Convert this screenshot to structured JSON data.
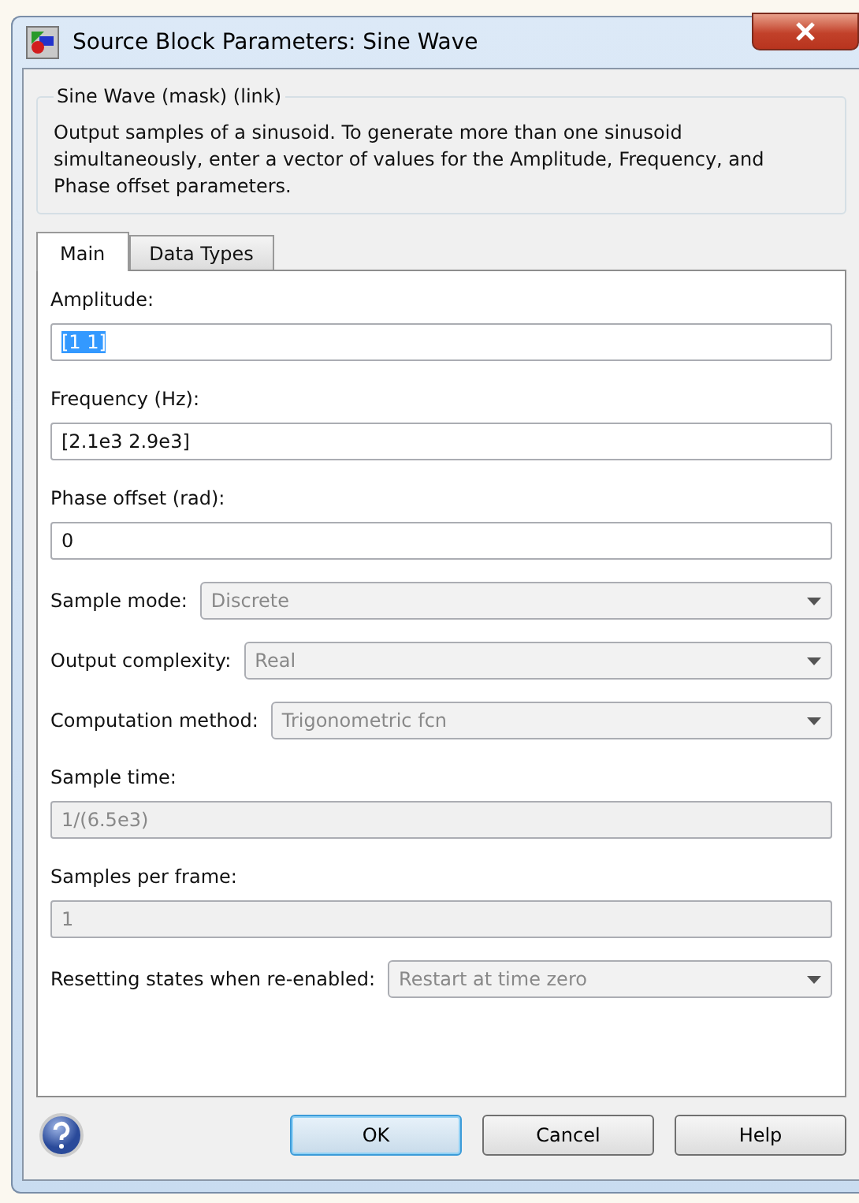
{
  "window": {
    "title": "Source Block Parameters: Sine Wave"
  },
  "group": {
    "title": "Sine Wave (mask) (link)",
    "description": "Output samples of a sinusoid.  To generate more than one sinusoid simultaneously, enter a vector of values for the Amplitude, Frequency, and Phase offset parameters."
  },
  "tabs": [
    {
      "label": "Main",
      "selected": true
    },
    {
      "label": "Data Types",
      "selected": false
    }
  ],
  "parameters": [
    {
      "kind": "text",
      "label": "Amplitude:",
      "value": "[1 1]",
      "disabled": false,
      "highlighted": true
    },
    {
      "kind": "text",
      "label": "Frequency (Hz):",
      "value": "[2.1e3 2.9e3]",
      "disabled": false,
      "highlighted": false
    },
    {
      "kind": "text",
      "label": "Phase offset (rad):",
      "value": "0",
      "disabled": false,
      "highlighted": false
    },
    {
      "kind": "dropdown",
      "label": "Sample mode:",
      "value": "Discrete",
      "disabled": true
    },
    {
      "kind": "dropdown",
      "label": "Output complexity:",
      "value": "Real",
      "disabled": true
    },
    {
      "kind": "dropdown",
      "label": "Computation method:",
      "value": "Trigonometric fcn",
      "disabled": true
    },
    {
      "kind": "text",
      "label": "Sample time:",
      "value": "1/(6.5e3)",
      "disabled": true,
      "highlighted": false
    },
    {
      "kind": "text",
      "label": "Samples per frame:",
      "value": "1",
      "disabled": true,
      "highlighted": false
    },
    {
      "kind": "dropdown",
      "label": "Resetting states when re-enabled:",
      "value": "Restart at time zero",
      "disabled": true
    }
  ],
  "buttons": [
    {
      "label": "OK",
      "default": true
    },
    {
      "label": "Cancel",
      "default": false
    },
    {
      "label": "Help",
      "default": false
    }
  ]
}
